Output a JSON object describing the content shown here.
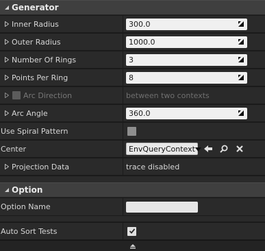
{
  "sections": {
    "generator": {
      "title": "Generator"
    },
    "option": {
      "title": "Option"
    }
  },
  "generator": {
    "inner_radius": {
      "label": "Inner Radius",
      "value": "300.0"
    },
    "outer_radius": {
      "label": "Outer Radius",
      "value": "1000.0"
    },
    "number_of_rings": {
      "label": "Number Of Rings",
      "value": "3"
    },
    "points_per_ring": {
      "label": "Points Per Ring",
      "value": "8"
    },
    "arc_direction": {
      "label": "Arc Direction",
      "value": "between two contexts"
    },
    "arc_angle": {
      "label": "Arc Angle",
      "value": "360.0"
    },
    "use_spiral_pattern": {
      "label": "Use Spiral Pattern",
      "checked": false
    },
    "center": {
      "label": "Center",
      "value": "EnvQueryContext"
    },
    "projection_data": {
      "label": "Projection Data",
      "value": "trace disabled"
    }
  },
  "option": {
    "option_name": {
      "label": "Option Name",
      "value": ""
    },
    "auto_sort_tests": {
      "label": "Auto Sort Tests",
      "checked": true
    }
  },
  "colors": {
    "panel_bg": "#1a1a1a",
    "row_bg": "#2a2a2a",
    "header_bg": "#3f3f3f",
    "input_bg": "#f0f0f0"
  }
}
